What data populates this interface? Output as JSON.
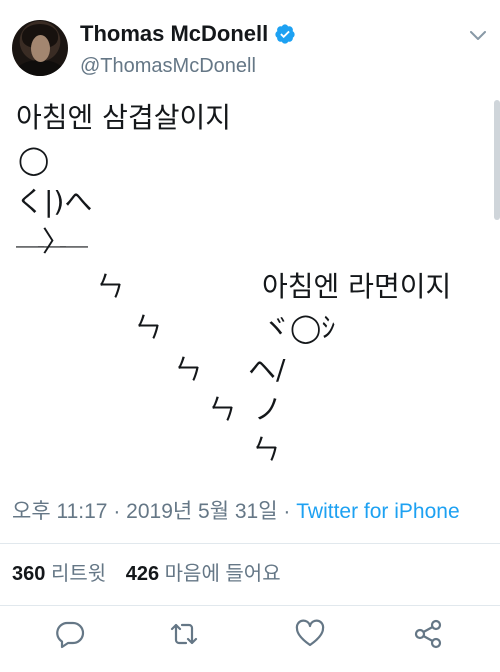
{
  "user": {
    "display_name": "Thomas McDonell",
    "handle": "@ThomasMcDonell",
    "verified": true
  },
  "tweet": {
    "lines": [
      "아침엔 삼겹살이지",
      "◯",
      "く|)へ",
      "〉",
      "￣￣￣",
      "ㄣ",
      "ㄣ",
      "ㄣ",
      "ㄣ",
      "아침엔 라면이지",
      "ヾ◯ｼ",
      "ヘ/",
      "ノ",
      "ㄣ"
    ]
  },
  "meta": {
    "time": "오후 11:17",
    "separator": "·",
    "date": "2019년 5월 31일",
    "source": "Twitter for iPhone"
  },
  "stats": {
    "retweets_count": "360",
    "retweets_label": "리트윗",
    "likes_count": "426",
    "likes_label": "마음에 들어요"
  },
  "icons": {
    "reply": "reply-icon",
    "retweet": "retweet-icon",
    "like": "heart-icon",
    "share": "share-icon",
    "verified": "verified-badge-icon",
    "more": "chevron-down-icon"
  },
  "colors": {
    "accent": "#1da1f2",
    "muted": "#657786",
    "text": "#14171a"
  }
}
